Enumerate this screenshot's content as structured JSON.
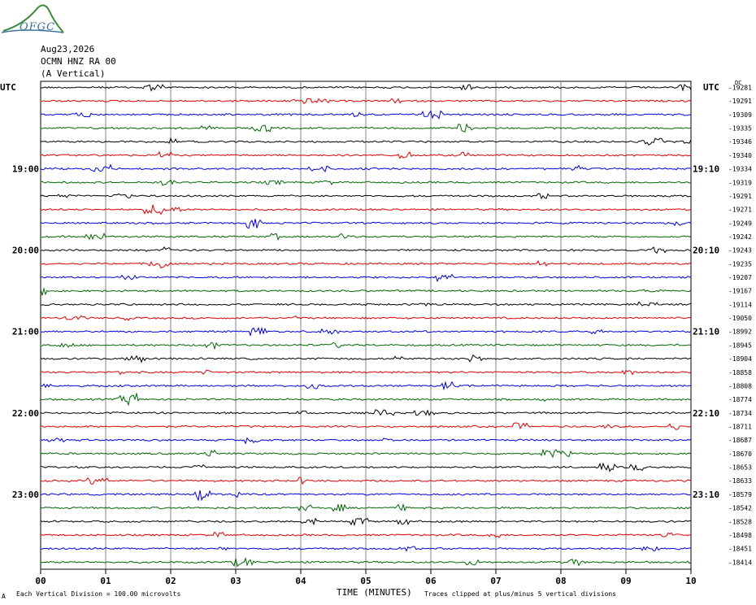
{
  "header": {
    "date": "Aug23,2026",
    "station": "OCMN HNZ RA 00",
    "component": "(A Vertical)",
    "logo_text": "OFGC",
    "utc_left": "UTC",
    "utc_right": "UTC",
    "dc_label": "DC"
  },
  "footer": {
    "scale_note": "Each Vertical Division =  100.00 microvolts",
    "xlabel": "TIME (MINUTES)",
    "clip_note": "Traces clipped at plus/minus 5 vertical divisions",
    "corner_mark": "A"
  },
  "colors": {
    "cycle": [
      "#000000",
      "#dd0000",
      "#0000dd",
      "#006600"
    ],
    "grid": "#808080"
  },
  "chart_data": {
    "type": "line",
    "title": "",
    "xlabel": "TIME (MINUTES)",
    "ylabel": "",
    "xlim": [
      0,
      10
    ],
    "x_ticks": [
      "00",
      "01",
      "02",
      "03",
      "04",
      "05",
      "06",
      "07",
      "08",
      "09",
      "10"
    ],
    "left_hour_labels": [
      {
        "trace": 6,
        "label": "19:00"
      },
      {
        "trace": 12,
        "label": "20:00"
      },
      {
        "trace": 18,
        "label": "21:00"
      },
      {
        "trace": 24,
        "label": "22:00"
      },
      {
        "trace": 30,
        "label": "23:00"
      }
    ],
    "right_hour_labels": [
      {
        "trace": 6,
        "label": "19:10"
      },
      {
        "trace": 12,
        "label": "20:10"
      },
      {
        "trace": 18,
        "label": "21:10"
      },
      {
        "trace": 24,
        "label": "22:10"
      },
      {
        "trace": 30,
        "label": "23:10"
      }
    ],
    "dc_offsets": [
      "-19281",
      "-19291",
      "-19309",
      "-19335",
      "-19346",
      "-19340",
      "-19334",
      "-19319",
      "-19291",
      "-19271",
      "-19249",
      "-19242",
      "-19243",
      "-19235",
      "-19207",
      "-19167",
      "-19114",
      "-19050",
      "-18992",
      "-18945",
      "-18904",
      "-18858",
      "-18808",
      "-18774",
      "-18734",
      "-18711",
      "-18687",
      "-18670",
      "-18653",
      "-18633",
      "-18579",
      "-18542",
      "-18528",
      "-18498",
      "-18451",
      "-18414"
    ],
    "clip_divisions": 5,
    "division_microvolts": 100.0
  }
}
